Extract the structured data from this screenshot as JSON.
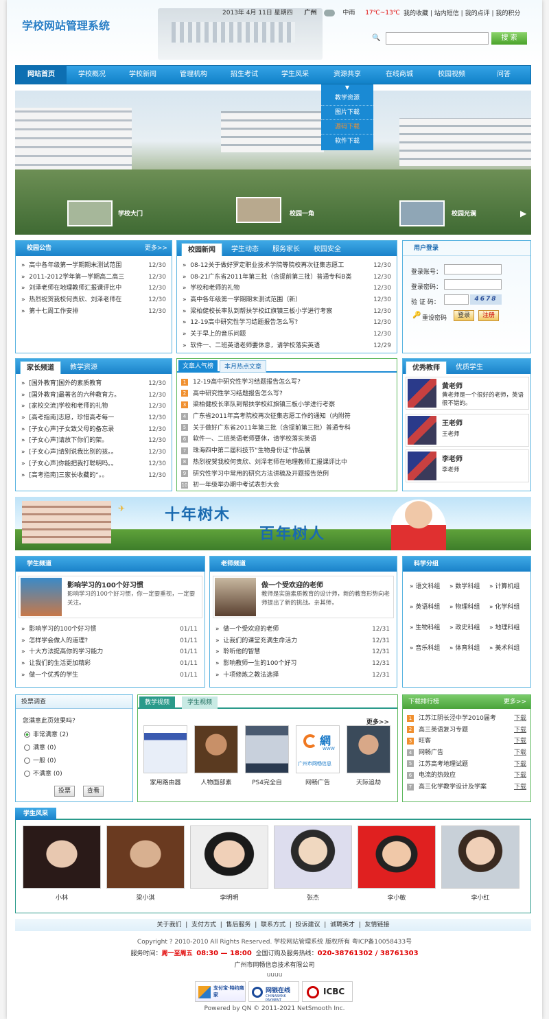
{
  "brand": "学校网站管理系统",
  "topbar": {
    "date": "2013年  4月  11日  星期四",
    "city": "广州",
    "weather": "中雨",
    "temp": "17℃~13℃",
    "links": [
      "我的收藏",
      "站内短信",
      "我的点评",
      "我的积分"
    ]
  },
  "search": {
    "placeholder": "",
    "button": "搜 索"
  },
  "nav": [
    "网站首页",
    "学校概况",
    "学校新闻",
    "管理机构",
    "招生考试",
    "学生风采",
    "资源共享",
    "在线商城",
    "校园视频",
    "问答"
  ],
  "dropdown": [
    "教学资源",
    "图片下载",
    "源码下载",
    "软件下载"
  ],
  "banner": {
    "thumbs": [
      "学校大门",
      "校园一角",
      "校园光澜"
    ]
  },
  "notice": {
    "title": "校园公告",
    "more": "更多>>",
    "items": [
      {
        "t": "高中各年级第一学期期末测试范围",
        "d": "12/30"
      },
      {
        "t": "2011-2012学年第一学期高二高三",
        "d": "12/30"
      },
      {
        "t": "刘泽老师在地理教师汇报课评比中",
        "d": "12/30"
      },
      {
        "t": "热烈祝贺我校何贵欣、刘泽老师在",
        "d": "12/30"
      },
      {
        "t": "第十七周工作安排",
        "d": "12/30"
      }
    ]
  },
  "news": {
    "tabs": [
      "校园新闻",
      "学生动态",
      "服务家长",
      "校园安全"
    ],
    "items": [
      {
        "t": "08-12关于做好罗定职业技术学院等院校再次征集志愿工",
        "d": "12/30"
      },
      {
        "t": "08-21广东省2011年第三批（含提前第三批）普通专科B类",
        "d": "12/30"
      },
      {
        "t": "学校和老师的礼物",
        "d": "12/30"
      },
      {
        "t": "高中各年级第一学期期末测试范围（新）",
        "d": "12/30"
      },
      {
        "t": "梁柏健校长率队到帮扶学校红旗镇三板小学进行考察",
        "d": "12/30"
      },
      {
        "t": "12-19高中研究性学习结题报告怎么写?",
        "d": "12/30"
      },
      {
        "t": "关于早上的音乐问题",
        "d": "12/30"
      },
      {
        "t": "软件一、二班英语老师要休息，请学校落实英语",
        "d": "12/29"
      }
    ]
  },
  "login": {
    "title": "用户登录",
    "account": "登录账号：",
    "password": "登录密码：",
    "code": "验 证 码：",
    "captcha": "4678",
    "forgot": "重设密码",
    "login": "登录",
    "register": "注册"
  },
  "parents": {
    "tabs": [
      "家长频道",
      "教学资源"
    ],
    "items": [
      {
        "t": "[国外教育]国外的素质教育",
        "d": "12/30"
      },
      {
        "t": "[国外教育]最著名的六种教育方。",
        "d": "12/30"
      },
      {
        "t": "[家校交流]学校和老师的礼物",
        "d": "12/30"
      },
      {
        "t": "[高考指南]志愿，珍惜高考每一",
        "d": "12/30"
      },
      {
        "t": "[子女心声]子女致父母的备忘录",
        "d": "12/30"
      },
      {
        "t": "[子女心声]请放下你们的架。",
        "d": "12/30"
      },
      {
        "t": "[子女心声]请别说我比别的孩。。",
        "d": "12/30"
      },
      {
        "t": "[子女心声]你能把我打聪明吗。。",
        "d": "12/30"
      },
      {
        "t": "[高考指南]三家长收藏的“。。",
        "d": "12/30"
      }
    ]
  },
  "hot": {
    "tabs": [
      "文章人气榜",
      "本月热点文章"
    ],
    "items": [
      "12-19高中研究性学习结题报告怎么写?",
      "高中研究性学习结题报告怎么写?",
      "梁柏健校长率队到帮扶学校红旗镇三板小学进行考察",
      "广东省2011年高考院校再次征集志愿工作的通知（内附符",
      "关于做好广东省2011年第三批（含提前第三批）普通专科",
      "软件一、二班英语老师要休，请学校落实英语",
      "珠海四中第二届科技节“生物身份证”作品展",
      "热烈祝贺我校何贵欣、刘泽老师在地理教师汇报课评比中",
      "研究性学习中常用的研究方法讲稿及开题报告范例",
      "初一年级举办期中考试表彰大会"
    ]
  },
  "teachers": {
    "tabs": [
      "优秀教师",
      "优质学生"
    ],
    "items": [
      {
        "name": "黄老师",
        "desc": "黄老师是一个很好的老师，英语很不错的。"
      },
      {
        "name": "王老师",
        "desc": "王老师"
      },
      {
        "name": "李老师",
        "desc": "李老师"
      }
    ]
  },
  "slogan": {
    "a": "十年树木",
    "b": "百年树人"
  },
  "student": {
    "title": "学生频道",
    "feature_title": "影响学习的100个好习惯",
    "feature_desc": "影响学习的100个好习惯，你一定要重视，一定要关注。",
    "items": [
      {
        "t": "影响学习的100个好习惯",
        "d": "01/11"
      },
      {
        "t": "怎样学会做人的道理?",
        "d": "01/11"
      },
      {
        "t": "十大方法提高你的学习能力",
        "d": "01/11"
      },
      {
        "t": "让我们的生活更加精彩",
        "d": "01/11"
      },
      {
        "t": "做一个优秀的学生",
        "d": "01/11"
      }
    ]
  },
  "teacher_ch": {
    "title": "老师频道",
    "feature_title": "做一个受欢迎的老师",
    "feature_desc": "教师是实施素质教育的设计师，新的教育形势向老师提出了新的挑战。亲其师，",
    "items": [
      {
        "t": "做一个受欢迎的老师",
        "d": "12/31"
      },
      {
        "t": "让我们的课堂充满生命活力",
        "d": "12/31"
      },
      {
        "t": "聆听他的智慧",
        "d": "12/31"
      },
      {
        "t": "影响教师一生的100个好习",
        "d": "12/31"
      },
      {
        "t": "十项修炼之教法选择",
        "d": "12/31"
      }
    ]
  },
  "science": {
    "title": "科学分组",
    "items": [
      "语文科组",
      "数学科组",
      "计算机组",
      "英语科组",
      "物理科组",
      "化学科组",
      "生物科组",
      "政史科组",
      "地理科组",
      "音乐科组",
      "体育科组",
      "美术科组"
    ]
  },
  "poll": {
    "title": "投票调查",
    "question": "您满意此页效果吗?",
    "options": [
      {
        "t": "非常满意",
        "n": "(2)"
      },
      {
        "t": "满意",
        "n": "(0)"
      },
      {
        "t": "一般",
        "n": "(0)"
      },
      {
        "t": "不满意",
        "n": "(0)"
      }
    ],
    "vote": "投票",
    "view": "查看"
  },
  "video": {
    "tabs": [
      "教学视频",
      "学生视频"
    ],
    "more": "更多>>",
    "items": [
      "家用路由器",
      "人物面部素",
      "PS4完全自",
      "网畅广告",
      "天际追劫"
    ],
    "logo_text": "广州市网畅信息",
    "logo_glyph": "網",
    "logo_sub": "WWW"
  },
  "download": {
    "title": "下载排行榜",
    "more": "更多>>",
    "link": "下载",
    "items": [
      "江苏江阴长泾中学2010届考",
      "高三英语复习专题",
      "旺客",
      "网畅广告",
      "江苏高考地理试题",
      "电流的热效应",
      "高三化学教学设计及学案"
    ]
  },
  "style": {
    "title": "学生风采",
    "names": [
      "小林",
      "梁小淇",
      "李明明",
      "张杰",
      "李小敏",
      "李小红"
    ]
  },
  "footer": {
    "links": [
      "关于我们",
      "支付方式",
      "售后服务",
      "联系方式",
      "投诉建议",
      "诚聘英才",
      "友情链接"
    ],
    "copyright": "Copyright ? 2010-2010 All Rights Reserved. 学校网站管理系统  版权所有   粤ICP备10058433号",
    "hours_label": "服务时间：",
    "hours_days": "周一至周五",
    "hours_time": "08:30 — 18:00",
    "phone_label": "全国订购及服务热线：",
    "phone": "020-38761302 / 38761303",
    "company": "广州市网畅信息技术有限公司",
    "uuuu": "uuuu",
    "badges": [
      "支付宝·特约商家",
      "网银在线",
      "ICBC"
    ],
    "badge_sub": "CHINABANK PAYMENT",
    "powered": "Powered by QN © 2011-2021 NetSmooth Inc."
  },
  "colors": {
    "nav": "#1a8ad4",
    "accent": "#f09030",
    "green": "#5cb85c",
    "red": "#e00000"
  }
}
